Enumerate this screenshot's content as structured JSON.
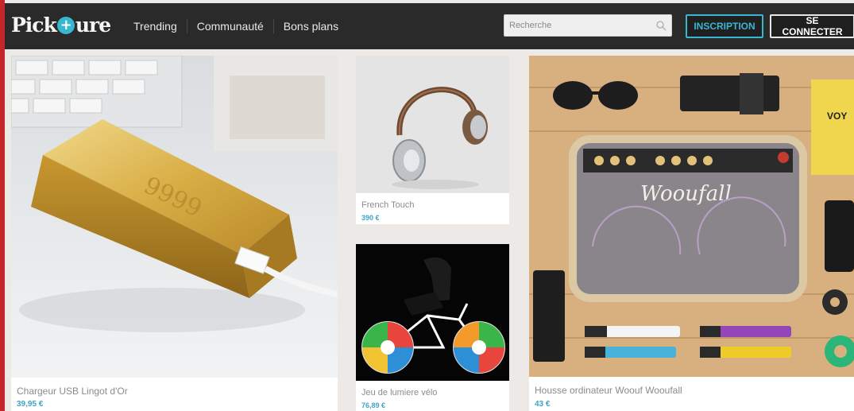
{
  "header": {
    "logo": {
      "before": "Pick",
      "after": "ure",
      "accent_color": "#36b6cf"
    },
    "nav": [
      "Trending",
      "Communauté",
      "Bons plans"
    ],
    "search": {
      "placeholder": "Recherche",
      "value": ""
    },
    "register_label": "INSCRIPTION",
    "login_label": "SE CONNECTER"
  },
  "products": [
    {
      "title": "Chargeur USB Lingot d'Or",
      "price": "39,95 €"
    },
    {
      "title": "French Touch",
      "price": "390 €"
    },
    {
      "title": "Jeu de lumiere vélo",
      "price": "76,89 €"
    },
    {
      "title": "Housse ordinateur Woouf Wooufall",
      "price": "43 €"
    }
  ],
  "image_text": {
    "gold_bar_engraving": "9999",
    "sleeve_brand": "Wooufall",
    "book_spine": "VOY"
  },
  "colors": {
    "header_bg": "#2a2a2a",
    "accent_red": "#c4262b",
    "accent_teal": "#38b7d2",
    "price": "#3da5c2"
  }
}
